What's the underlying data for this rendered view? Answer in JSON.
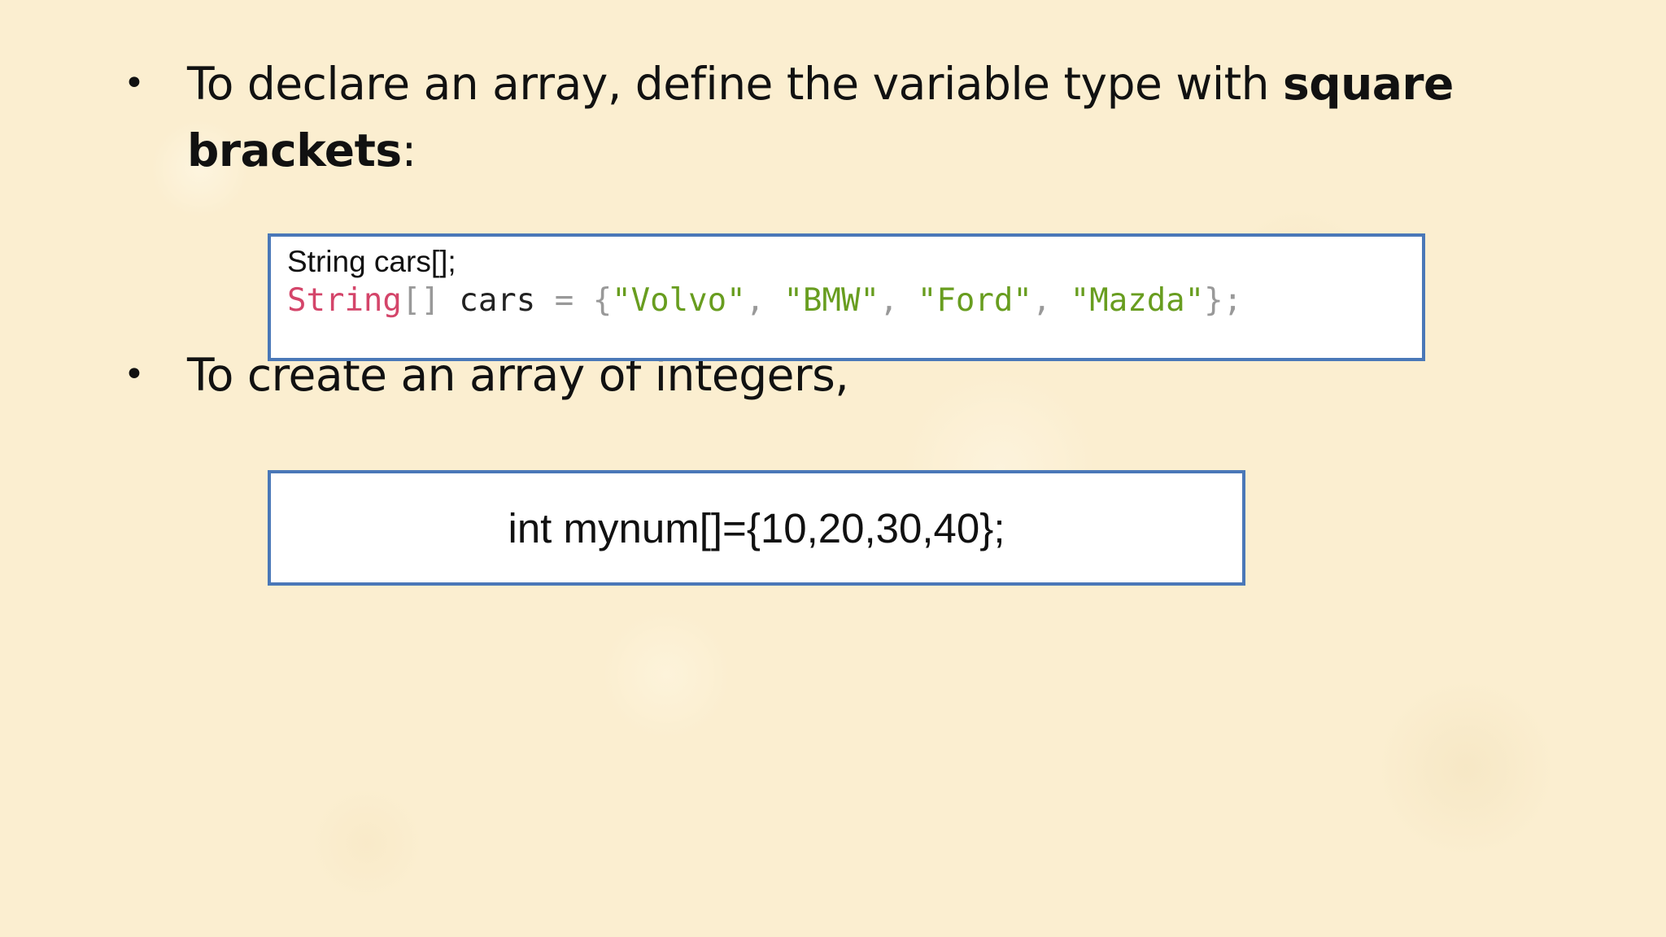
{
  "bullets": [
    {
      "text_pre": "To declare an array, define the variable type with ",
      "text_bold": "square brackets",
      "text_post": ":"
    },
    {
      "text": "To create an array of integers,"
    }
  ],
  "code_box_1": {
    "declaration": "String cars[];",
    "code_tokens": [
      {
        "text": "String",
        "kind": "type"
      },
      {
        "text": "[]",
        "kind": "punc"
      },
      {
        "text": " cars ",
        "kind": "ident"
      },
      {
        "text": "=",
        "kind": "punc"
      },
      {
        "text": " ",
        "kind": "ident"
      },
      {
        "text": "{",
        "kind": "punc"
      },
      {
        "text": "\"Volvo\"",
        "kind": "str"
      },
      {
        "text": ", ",
        "kind": "punc"
      },
      {
        "text": "\"BMW\"",
        "kind": "str"
      },
      {
        "text": ", ",
        "kind": "punc"
      },
      {
        "text": "\"Ford\"",
        "kind": "str"
      },
      {
        "text": ", ",
        "kind": "punc"
      },
      {
        "text": "\"Mazda\"",
        "kind": "str"
      },
      {
        "text": "};",
        "kind": "punc"
      }
    ]
  },
  "code_box_2": {
    "code": "int mynum[]={10,20,30,40};"
  },
  "colors": {
    "background": "#fbeed0",
    "box_border": "#4a78b8",
    "type_keyword": "#d4456a",
    "string_literal": "#689d1f",
    "punctuation": "#999999"
  }
}
